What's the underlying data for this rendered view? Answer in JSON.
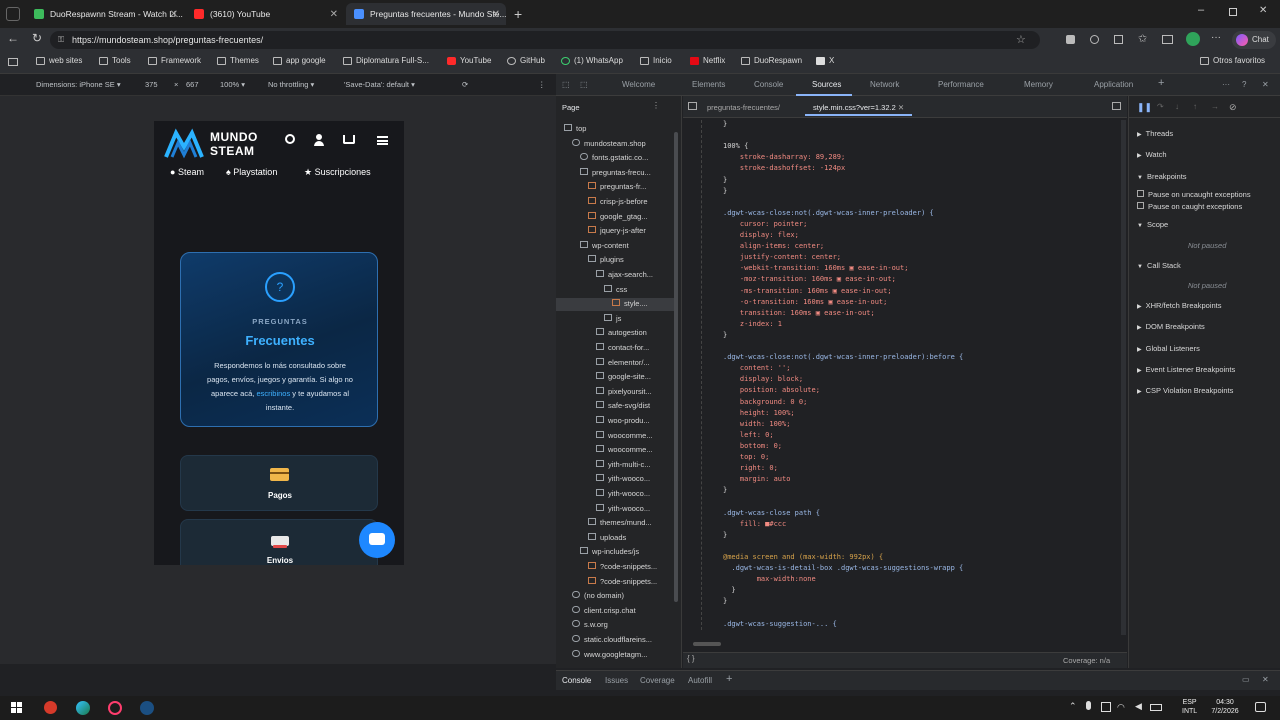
{
  "tabs": [
    {
      "title": "DuoRespawnn Stream - Watch Li...",
      "color": "#3dbb5c"
    },
    {
      "title": "(3610) YouTube",
      "color": "#ff2a2a"
    },
    {
      "title": "Preguntas frecuentes - Mundo Ste...",
      "color": "#4a90ff"
    }
  ],
  "address": {
    "url": "https://mundosteam.shop/preguntas-frecuentes/"
  },
  "bookmarks": [
    "web sites",
    "Tools",
    "Framework",
    "Themes",
    "app google",
    "Diplomatura Full-S...",
    "YouTube",
    "GitHub",
    "(1) WhatsApp",
    "Inicio",
    "Netflix",
    "DuoRespawn",
    "X"
  ],
  "other_favorites": "Otros favoritos",
  "emulation": {
    "dimensions": "Dimensions: iPhone SE ▾",
    "width": "375",
    "x": "×",
    "height": "667",
    "zoom": "100% ▾",
    "throttle": "No throttling ▾",
    "savedata": "'Save-Data': default ▾"
  },
  "phone": {
    "logo_line1": "MUNDO",
    "logo_line2": "STEAM",
    "nav": [
      "Steam",
      "Playstation",
      "Suscripciones"
    ],
    "card_kicker": "PREGUNTAS",
    "card_title": "Frecuentes",
    "card_text_1": "Respondemos lo más consultado sobre",
    "card_text_2": "pagos, envíos, juegos y garantía. Si algo no",
    "card_text_3a": "aparece acá, ",
    "card_link": "escribinos",
    "card_text_3b": " y te ayudamos al",
    "card_text_4": "instante.",
    "tile1": "Pagos",
    "tile2": "Envios"
  },
  "devtools_tabs": [
    "Welcome",
    "Elements",
    "Console",
    "Sources",
    "Network",
    "Performance",
    "Memory",
    "Application"
  ],
  "sources": {
    "page_label": "Page",
    "open_file1": "preguntas-frecuentes/",
    "open_file2": "style.min.css?ver=1.32.2"
  },
  "tree": [
    "top",
    "mundosteam.shop",
    "fonts.gstatic.co...",
    "preguntas-frecu...",
    "preguntas-fr...",
    "crisp-js-before",
    "google_gtag...",
    "jquery-js-after",
    "wp-content",
    "plugins",
    "ajax-search...",
    "css",
    "style....",
    "js",
    "autogestion",
    "contact-for...",
    "elementor/...",
    "google-site...",
    "pixelyoursit...",
    "safe-svg/dist",
    "woo-produ...",
    "woocomme...",
    "woocomme...",
    "yith-multi-c...",
    "yith-wooco...",
    "yith-wooco...",
    "yith-wooco...",
    "themes/mund...",
    "uploads",
    "wp-includes/js",
    "?code-snippets...",
    "?code-snippets...",
    "(no domain)",
    "client.crisp.chat",
    "s.w.org",
    "static.cloudflareins...",
    "www.googletagm..."
  ],
  "code": [
    "}",
    "",
    "100% {",
    "    stroke-dasharray: 89,289;",
    "    stroke-dashoffset: -124px",
    "}",
    "}",
    "",
    ".dgwt-wcas-close:not(.dgwt-wcas-inner-preloader) {",
    "    cursor: pointer;",
    "    display: flex;",
    "    align-items: center;",
    "    justify-content: center;",
    "    -webkit-transition: 160ms ▣ ease-in-out;",
    "    -moz-transition: 160ms ▣ ease-in-out;",
    "    -ms-transition: 160ms ▣ ease-in-out;",
    "    -o-transition: 160ms ▣ ease-in-out;",
    "    transition: 160ms ▣ ease-in-out;",
    "    z-index: 1",
    "}",
    "",
    ".dgwt-wcas-close:not(.dgwt-wcas-inner-preloader):before {",
    "    content: '';",
    "    display: block;",
    "    position: absolute;",
    "    background: 0 0;",
    "    height: 100%;",
    "    width: 100%;",
    "    left: 0;",
    "    bottom: 0;",
    "    top: 0;",
    "    right: 0;",
    "    margin: auto",
    "}",
    "",
    ".dgwt-wcas-close path {",
    "    fill: ■#ccc",
    "}",
    "",
    "@media screen and (max-width: 992px) {",
    "  .dgwt-wcas-is-detail-box .dgwt-wcas-suggestions-wrapp {",
    "        max-width:none",
    "  }",
    "}",
    "",
    ".dgwt-wcas-suggestion-... {"
  ],
  "coverage": "Coverage: n/a",
  "brace": "{ }",
  "debugger": [
    "Threads",
    "Watch",
    "Breakpoints",
    "Pause on uncaught exceptions",
    "Pause on caught exceptions",
    "Scope",
    "Not paused",
    "Call Stack",
    "Not paused",
    "XHR/fetch Breakpoints",
    "DOM Breakpoints",
    "Global Listeners",
    "Event Listener Breakpoints",
    "CSP Violation Breakpoints"
  ],
  "drawer_tabs": [
    "Console",
    "Issues",
    "Coverage",
    "Autofill"
  ],
  "taskbar": {
    "lang1": "ESP",
    "lang2": "INTL",
    "time": "04:30",
    "date": "7/2/2026"
  }
}
